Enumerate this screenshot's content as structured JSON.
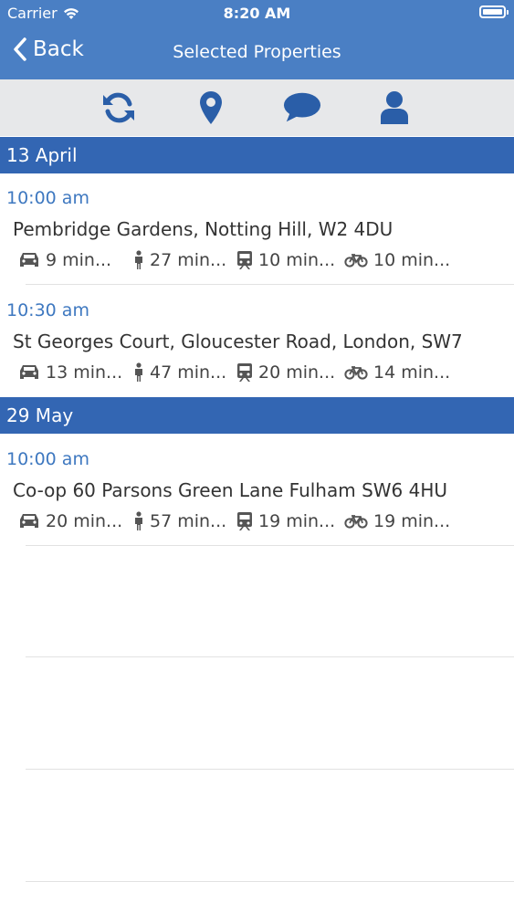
{
  "status_bar": {
    "carrier": "Carrier",
    "time": "8:20 AM"
  },
  "nav": {
    "back_label": "Back",
    "title": "Selected Properties"
  },
  "toolbar": {
    "icons": [
      "refresh-icon",
      "map-pin-icon",
      "chat-bubble-icon",
      "user-icon"
    ]
  },
  "colors": {
    "nav_bar": "#4a7fc4",
    "section_header": "#3366b3",
    "time_text": "#3e78c0",
    "toolbar_bg": "#e7e8ea",
    "icon": "#2a5ea8"
  },
  "sections": [
    {
      "date": "13 April",
      "items": [
        {
          "time": "10:00 am",
          "address": "Pembridge Gardens, Notting Hill, W2 4DU",
          "car": "9 min...",
          "walk": "27 min...",
          "train": "10 min...",
          "bike": "10 min..."
        },
        {
          "time": "10:30 am",
          "address": "St Georges Court, Gloucester Road, London, SW7",
          "car": "13 min...",
          "walk": "47 min...",
          "train": "20 min...",
          "bike": "14 min..."
        }
      ]
    },
    {
      "date": "29 May",
      "items": [
        {
          "time": "10:00 am",
          "address": "Co-op 60 Parsons Green Lane  Fulham  SW6 4HU",
          "car": "20 min...",
          "walk": "57 min...",
          "train": "19 min...",
          "bike": "19 min..."
        }
      ]
    }
  ]
}
